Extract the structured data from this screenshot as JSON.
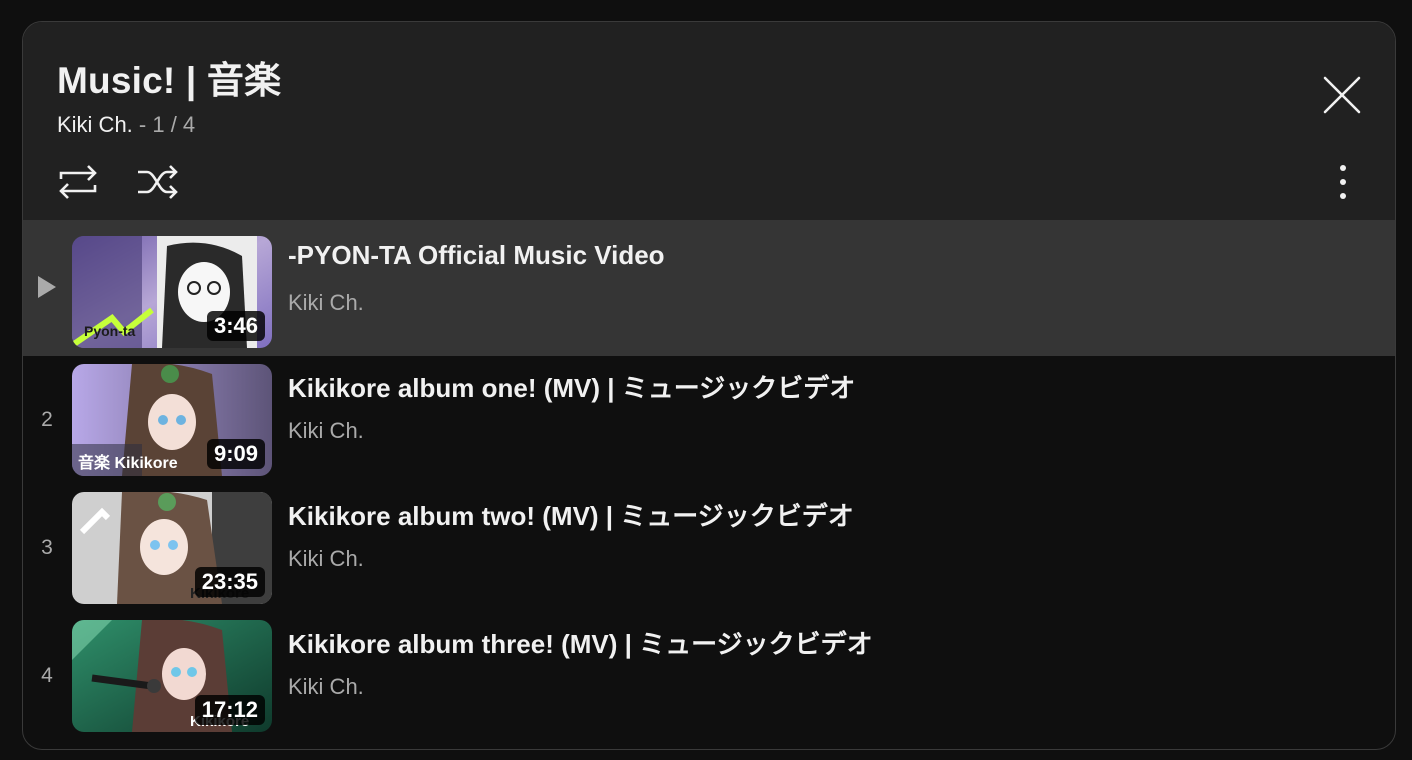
{
  "playlist": {
    "title": "Music! | 音楽",
    "channel": "Kiki Ch.",
    "separator": " - ",
    "position": "1 / 4"
  },
  "icons": {
    "close": "close-icon",
    "loop": "loop-icon",
    "shuffle": "shuffle-icon",
    "more": "more-vertical-icon",
    "now_playing": "play-triangle-icon"
  },
  "colors": {
    "panel_bg": "#0f0f0f",
    "header_bg": "#212121",
    "active_row_bg": "#353535",
    "text_primary": "#f1f1f1",
    "text_secondary": "#aaaaaa"
  },
  "videos": [
    {
      "index": "",
      "now_playing": true,
      "title": "-PYON-TA Official Music Video",
      "channel": "Kiki Ch.",
      "duration": "3:46",
      "thumb_text": "Pyon-ta"
    },
    {
      "index": "2",
      "now_playing": false,
      "title": "Kikikore album one! (MV) | ミュージックビデオ",
      "channel": "Kiki Ch.",
      "duration": "9:09",
      "thumb_text": "音楽 Kikikore"
    },
    {
      "index": "3",
      "now_playing": false,
      "title": "Kikikore album two! (MV) | ミュージックビデオ",
      "channel": "Kiki Ch.",
      "duration": "23:35",
      "thumb_text": "Kikikore"
    },
    {
      "index": "4",
      "now_playing": false,
      "title": "Kikikore album three! (MV) | ミュージックビデオ",
      "channel": "Kiki Ch.",
      "duration": "17:12",
      "thumb_text": "Kikikore"
    }
  ]
}
